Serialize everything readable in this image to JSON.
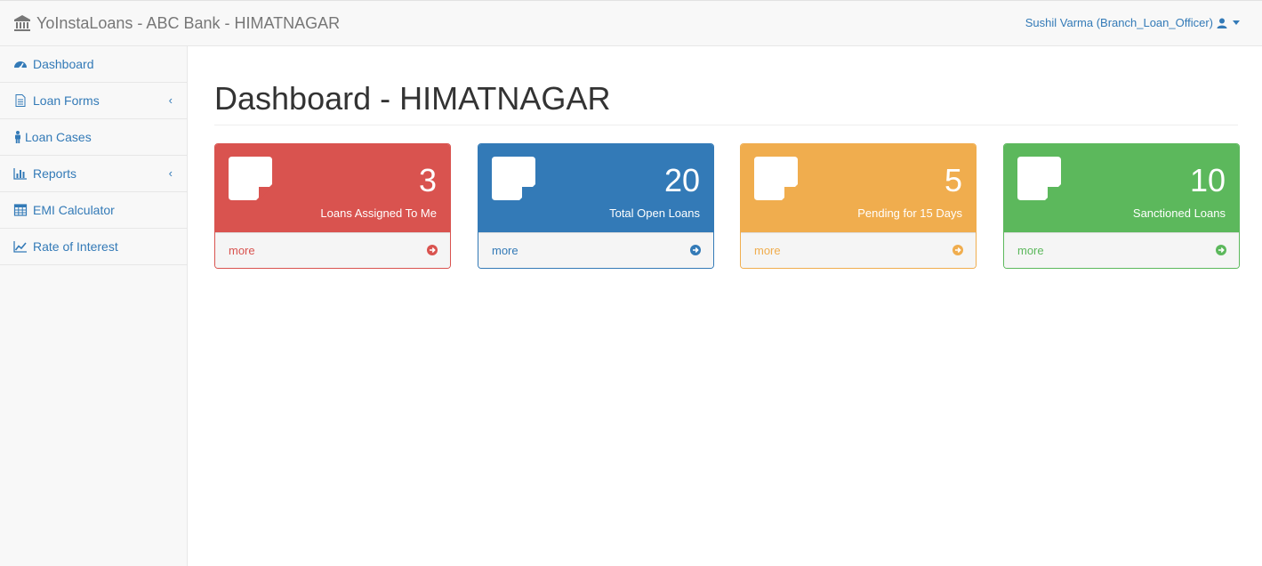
{
  "navbar": {
    "brand": "YoInstaLoans - ABC Bank - HIMATNAGAR",
    "user": "Sushil Varma (Branch_Loan_Officer)"
  },
  "sidebar": {
    "items": [
      {
        "label": "Dashboard",
        "icon": "dashboard-icon",
        "has_chevron": false
      },
      {
        "label": "Loan Forms",
        "icon": "file-icon",
        "has_chevron": true
      },
      {
        "label": "Loan Cases",
        "icon": "person-icon",
        "has_chevron": false
      },
      {
        "label": "Reports",
        "icon": "bar-chart-icon",
        "has_chevron": true
      },
      {
        "label": "EMI Calculator",
        "icon": "table-icon",
        "has_chevron": false
      },
      {
        "label": "Rate of Interest",
        "icon": "line-chart-icon",
        "has_chevron": false
      }
    ],
    "chevron": "‹"
  },
  "main": {
    "title": "Dashboard - HIMATNAGAR"
  },
  "panels": [
    {
      "count": "3",
      "label": "Loans Assigned To Me",
      "more": "more",
      "color": "#d9534f"
    },
    {
      "count": "20",
      "label": "Total Open Loans",
      "more": "more",
      "color": "#337ab7"
    },
    {
      "count": "5",
      "label": "Pending for 15 Days",
      "more": "more",
      "color": "#f0ad4e"
    },
    {
      "count": "10",
      "label": "Sanctioned Loans",
      "more": "more",
      "color": "#5cb85c"
    }
  ]
}
